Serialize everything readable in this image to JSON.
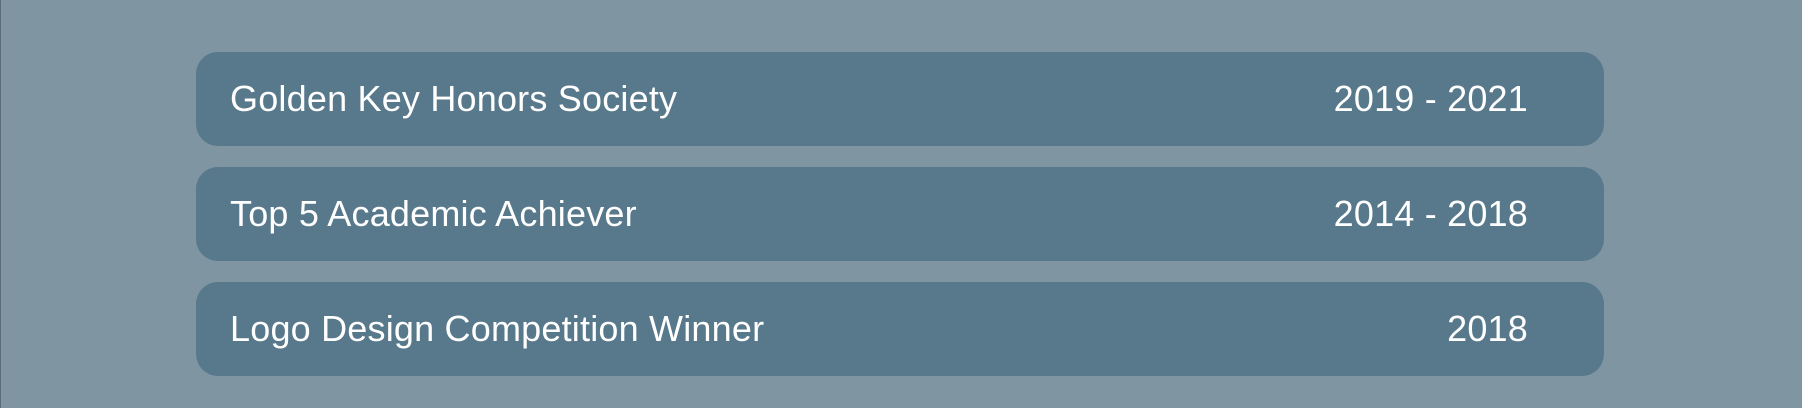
{
  "awards": [
    {
      "title": "Golden Key Honors Society",
      "years": "2019 - 2021"
    },
    {
      "title": "Top 5 Academic Achiever",
      "years": "2014 - 2018"
    },
    {
      "title": "Logo Design Competition Winner",
      "years": "2018"
    }
  ],
  "colors": {
    "background": "#7f95a2",
    "card": "#58798c",
    "text": "#ffffff"
  }
}
